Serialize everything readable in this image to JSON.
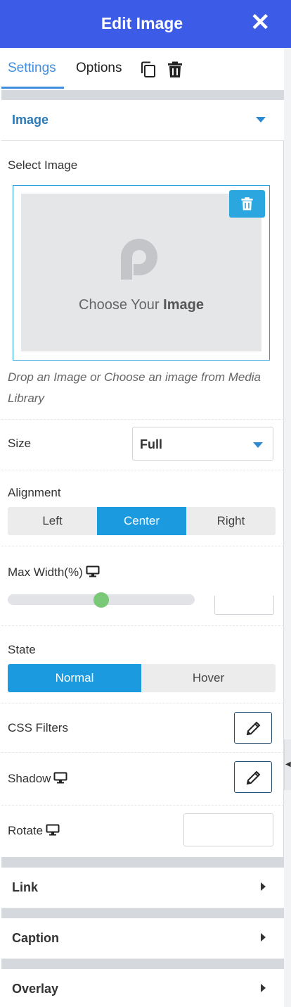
{
  "header": {
    "title": "Edit Image",
    "close_label": "✕"
  },
  "tabs": [
    {
      "label": "Settings",
      "active": true
    },
    {
      "label": "Options",
      "active": false
    }
  ],
  "toolbar_icons": [
    "copy-icon",
    "trash-icon"
  ],
  "image_section": {
    "title": "Image",
    "select_image_label": "Select Image",
    "placeholder_prefix": "Choose  Your ",
    "placeholder_bold": "Image",
    "help_text": "Drop an Image or Choose an image from Media Library",
    "size_label": "Size",
    "size_value": "Full",
    "alignment_label": "Alignment",
    "alignment_options": [
      "Left",
      "Center",
      "Right"
    ],
    "alignment_selected": "Center",
    "max_width_label": "Max Width(%)",
    "max_width_slider_fraction": 0.5,
    "state_label": "State",
    "state_options": [
      "Normal",
      "Hover"
    ],
    "state_selected": "Normal",
    "css_filters_label": "CSS Filters",
    "shadow_label": "Shadow",
    "rotate_label": "Rotate"
  },
  "collapsed_sections": [
    "Link",
    "Caption",
    "Overlay"
  ],
  "colors": {
    "header_bg": "#3c5be6",
    "accent_blue": "#1c9ae0",
    "tab_active": "#3f8ee0",
    "slider_thumb": "#79c978"
  }
}
